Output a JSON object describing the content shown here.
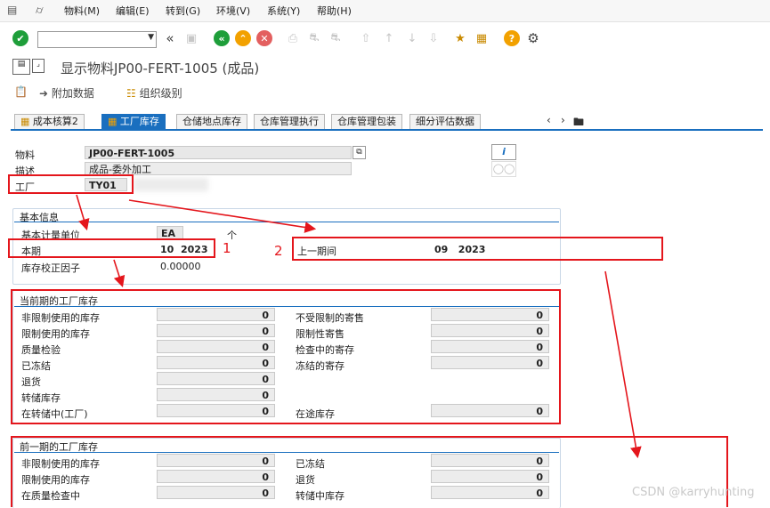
{
  "menubar": {
    "items": [
      "物料(M)",
      "编辑(E)",
      "转到(G)",
      "环境(V)",
      "系统(Y)",
      "帮助(H)"
    ]
  },
  "toolbar": {
    "command_value": ""
  },
  "title": "显示物料JP00-FERT-1005 (成品)",
  "app_toolbar": {
    "additional_data": "附加数据",
    "org_levels": "组织级别"
  },
  "tabs": [
    "成本核算2",
    "工厂库存",
    "仓储地点库存",
    "仓库管理执行",
    "仓库管理包装",
    "细分评估数据"
  ],
  "header": {
    "material_label": "物料",
    "material_value": "JP00-FERT-1005",
    "desc_label": "描述",
    "desc_value": "成品-委外加工",
    "plant_label": "工厂",
    "plant_value": "TY01"
  },
  "basic": {
    "title": "基本信息",
    "uom_label": "基本计量单位",
    "uom_value": "EA",
    "uom_text": "个",
    "period_label": "本期",
    "period_value": "10  2023",
    "prev_period_label": "上一期间",
    "prev_period_value": "09   2023",
    "correction_label": "库存校正因子",
    "correction_value": "0.00000"
  },
  "annotations": {
    "one": "1",
    "two": "2"
  },
  "current": {
    "title": "当前期的工厂库存",
    "left": [
      {
        "label": "非限制使用的库存",
        "value": "0"
      },
      {
        "label": "限制使用的库存",
        "value": "0"
      },
      {
        "label": "质量检验",
        "value": "0"
      },
      {
        "label": "已冻结",
        "value": "0"
      },
      {
        "label": "退货",
        "value": "0"
      },
      {
        "label": "转储库存",
        "value": "0"
      },
      {
        "label": "在转储中(工厂)",
        "value": "0"
      }
    ],
    "right": [
      {
        "label": "不受限制的寄售",
        "value": "0"
      },
      {
        "label": "限制性寄售",
        "value": "0"
      },
      {
        "label": "检查中的寄存",
        "value": "0"
      },
      {
        "label": "冻结的寄存",
        "value": "0"
      }
    ],
    "transit_label": "在途库存",
    "transit_value": "0"
  },
  "previous": {
    "title": "前一期的工厂库存",
    "left": [
      {
        "label": "非限制使用的库存",
        "value": "0"
      },
      {
        "label": "限制使用的库存",
        "value": "0"
      },
      {
        "label": "在质量检查中",
        "value": "0"
      }
    ],
    "right": [
      {
        "label": "已冻结",
        "value": "0"
      },
      {
        "label": "退货",
        "value": "0"
      },
      {
        "label": "转储中库存",
        "value": "0"
      }
    ]
  },
  "watermark": "CSDN @karryhunting",
  "colors": {
    "accent": "#1a6fbf",
    "annotation": "#e4161c",
    "ok_green": "#1e9e3a",
    "help_orange": "#f2a100"
  }
}
